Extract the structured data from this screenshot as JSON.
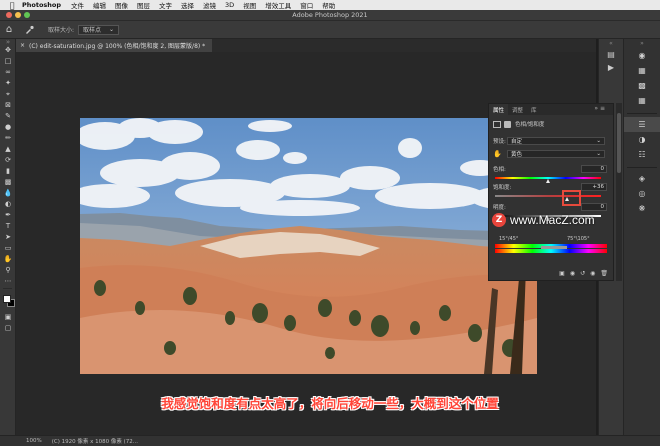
{
  "menubar": {
    "app_name": "Photoshop",
    "items": [
      "文件",
      "编辑",
      "图像",
      "图层",
      "文字",
      "选择",
      "滤镜",
      "3D",
      "视图",
      "增效工具",
      "窗口",
      "帮助"
    ]
  },
  "window": {
    "title": "Adobe Photoshop 2021"
  },
  "options": {
    "sample_size_label": "取样大小:",
    "sample_size_value": "取样点"
  },
  "document": {
    "tab_title": "(C) edit-saturation.jpg @ 100% (色相/饱和度 2, 图层蒙版/8) *"
  },
  "properties": {
    "tabs": [
      "属性",
      "调整",
      "库"
    ],
    "header": "色相/饱和度",
    "preset_label": "预设:",
    "preset_value": "自定",
    "channel_value": "黄色",
    "hue_label": "色相:",
    "hue_value": "0",
    "saturation_label": "饱和度:",
    "saturation_value": "+36",
    "lightness_label": "明度:",
    "lightness_value": "0",
    "range_left": "15°/45°",
    "range_right": "75°\\105°",
    "hue_fraction": 0.5,
    "saturation_fraction": 0.68,
    "lightness_fraction": 0.5
  },
  "watermark": {
    "text": "www.MacZ.com",
    "logo_letter": "Z"
  },
  "subtitle": "我感觉饱和度有点太高了，将向后移动一些，大概到这个位置",
  "status": {
    "zoom": "100%",
    "doc_info": "(C) 1920 像素 x 1080 像素 (72..."
  },
  "colors": {
    "accent_red": "#e64a3c",
    "subtitle_red": "#ff4538"
  }
}
